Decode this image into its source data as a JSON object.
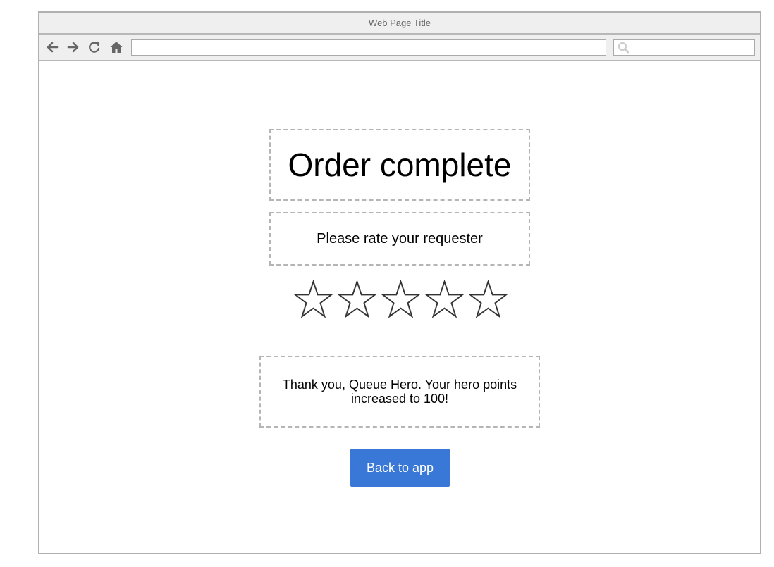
{
  "window": {
    "title": "Web Page Title"
  },
  "browser": {
    "address_value": "",
    "search_value": ""
  },
  "main": {
    "title": "Order complete",
    "prompt": "Please rate your requester",
    "rating": {
      "max_stars": 5,
      "selected": 0
    },
    "thanks_prefix": "Thank you, Queue Hero. Your hero points increased to ",
    "points": "100",
    "thanks_suffix": "!",
    "back_button_label": "Back to app"
  },
  "colors": {
    "accent": "#3a78d8",
    "chrome": "#efefef",
    "border": "#b5b5b5"
  }
}
